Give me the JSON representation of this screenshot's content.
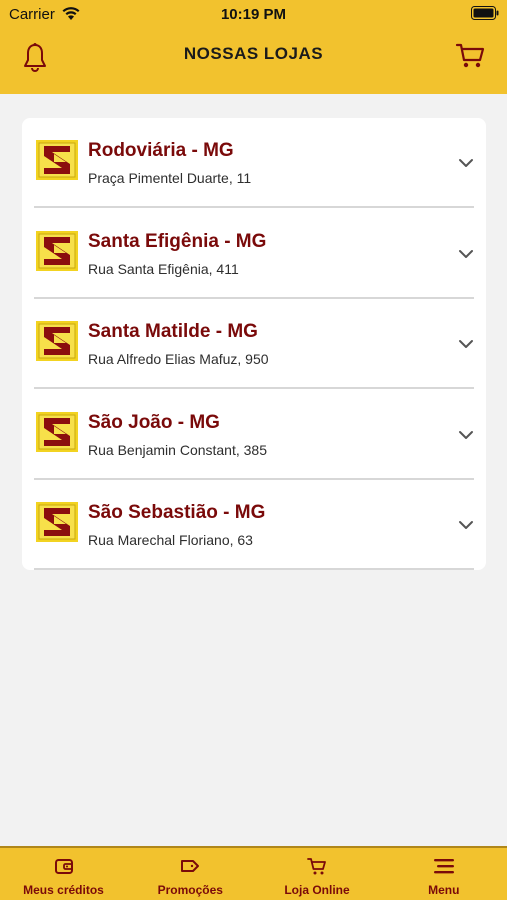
{
  "status_bar": {
    "carrier": "Carrier",
    "time": "10:19 PM"
  },
  "header": {
    "title": "NOSSAS LOJAS",
    "left_icon": "bell-icon",
    "right_icon": "cart-icon"
  },
  "stores": [
    {
      "name": "Rodoviária - MG",
      "address": "Praça Pimentel Duarte, 11"
    },
    {
      "name": "Santa Efigênia - MG",
      "address": "Rua Santa Efigênia, 411"
    },
    {
      "name": "Santa Matilde - MG",
      "address": "Rua Alfredo Elias Mafuz, 950"
    },
    {
      "name": "São João - MG",
      "address": "Rua Benjamin Constant, 385"
    },
    {
      "name": "São Sebastião - MG",
      "address": "Rua Marechal Floriano, 63"
    }
  ],
  "tabbar": [
    {
      "label": "Meus créditos",
      "icon": "wallet-icon"
    },
    {
      "label": "Promoções",
      "icon": "tag-icon"
    },
    {
      "label": "Loja Online",
      "icon": "cart-icon"
    },
    {
      "label": "Menu",
      "icon": "menu-icon"
    }
  ],
  "colors": {
    "brand_yellow": "#f2c22e",
    "brand_red": "#7a0a0a",
    "background": "#f2f2f2"
  }
}
